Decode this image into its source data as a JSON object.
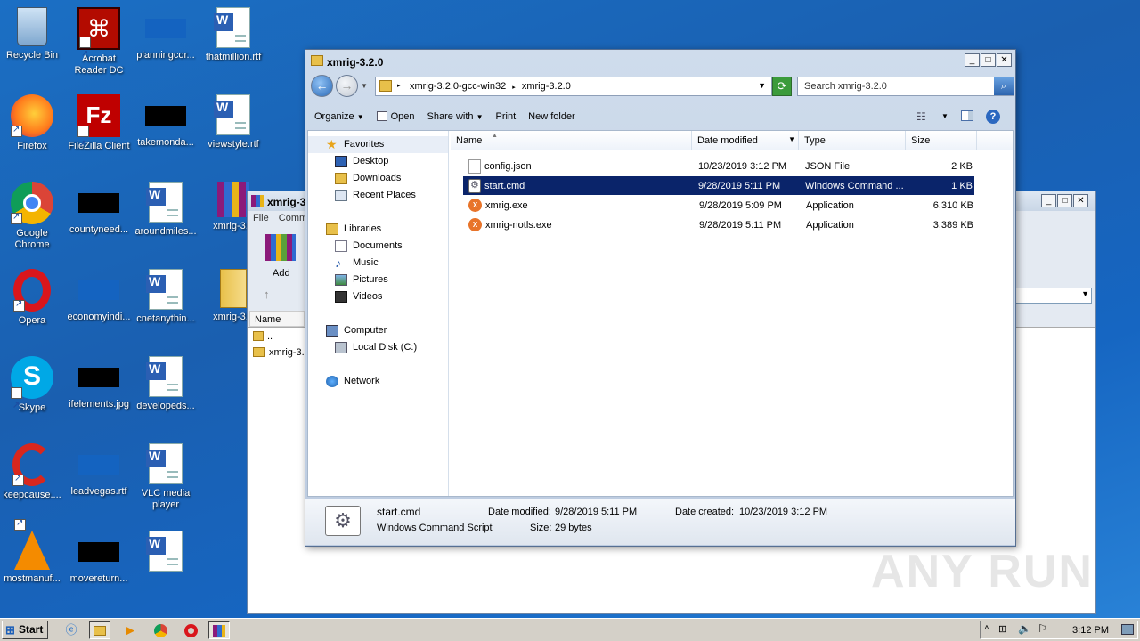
{
  "desktop": {
    "icons": [
      {
        "label": "Recycle Bin"
      },
      {
        "label": "Acrobat Reader DC"
      },
      {
        "label": "planningcor..."
      },
      {
        "label": "thatmillion.rtf"
      },
      {
        "label": "Firefox"
      },
      {
        "label": "FileZilla Client"
      },
      {
        "label": "takemonda..."
      },
      {
        "label": "viewstyle.rtf"
      },
      {
        "label": "Google Chrome"
      },
      {
        "label": "countyneed..."
      },
      {
        "label": "aroundmiles..."
      },
      {
        "label": "xmrig-3.2"
      },
      {
        "label": "Opera"
      },
      {
        "label": "economyindi..."
      },
      {
        "label": "cnetanythin..."
      },
      {
        "label": "xmrig-3.2"
      },
      {
        "label": "Skype"
      },
      {
        "label": "ifelements.jpg"
      },
      {
        "label": "developeds..."
      },
      {
        "label": "CCleaner"
      },
      {
        "label": "keepcause...."
      },
      {
        "label": "leadvegas.rtf"
      },
      {
        "label": "VLC media player"
      },
      {
        "label": "movereturn..."
      },
      {
        "label": "mostmanuf..."
      }
    ]
  },
  "backwin": {
    "title": "xmrig-3.2",
    "menu_file": "File",
    "menu_cmd": "Comma",
    "add_label": "Add",
    "col_name": "Name",
    "rows": [
      "..",
      "xmrig-3."
    ]
  },
  "explorer": {
    "title": "xmrig-3.2.0",
    "breadcrumb": [
      "xmrig-3.2.0-gcc-win32",
      "xmrig-3.2.0"
    ],
    "search_placeholder": "Search xmrig-3.2.0",
    "toolbar": {
      "organize": "Organize",
      "open": "Open",
      "share_with": "Share with",
      "print": "Print",
      "new_folder": "New folder"
    },
    "nav": {
      "favorites": "Favorites",
      "desktop": "Desktop",
      "downloads": "Downloads",
      "recent_places": "Recent Places",
      "libraries": "Libraries",
      "documents": "Documents",
      "music": "Music",
      "pictures": "Pictures",
      "videos": "Videos",
      "computer": "Computer",
      "local_disk": "Local Disk (C:)",
      "network": "Network"
    },
    "columns": {
      "name": "Name",
      "date_modified": "Date modified",
      "type": "Type",
      "size": "Size"
    },
    "files": [
      {
        "name": "config.json",
        "date": "10/23/2019 3:12 PM",
        "type": "JSON File",
        "size": "2 KB"
      },
      {
        "name": "start.cmd",
        "date": "9/28/2019 5:11 PM",
        "type": "Windows Command ...",
        "size": "1 KB"
      },
      {
        "name": "xmrig.exe",
        "date": "9/28/2019 5:09 PM",
        "type": "Application",
        "size": "6,310 KB"
      },
      {
        "name": "xmrig-notls.exe",
        "date": "9/28/2019 5:11 PM",
        "type": "Application",
        "size": "3,389 KB"
      }
    ],
    "details": {
      "filename": "start.cmd",
      "filetype": "Windows Command Script",
      "modified_label": "Date modified:",
      "modified": "9/28/2019 5:11 PM",
      "created_label": "Date created:",
      "created": "10/23/2019 3:12 PM",
      "size_label": "Size:",
      "size": "29 bytes"
    }
  },
  "taskbar": {
    "start": "Start",
    "clock": "3:12 PM"
  },
  "watermark": "ANY RUN"
}
